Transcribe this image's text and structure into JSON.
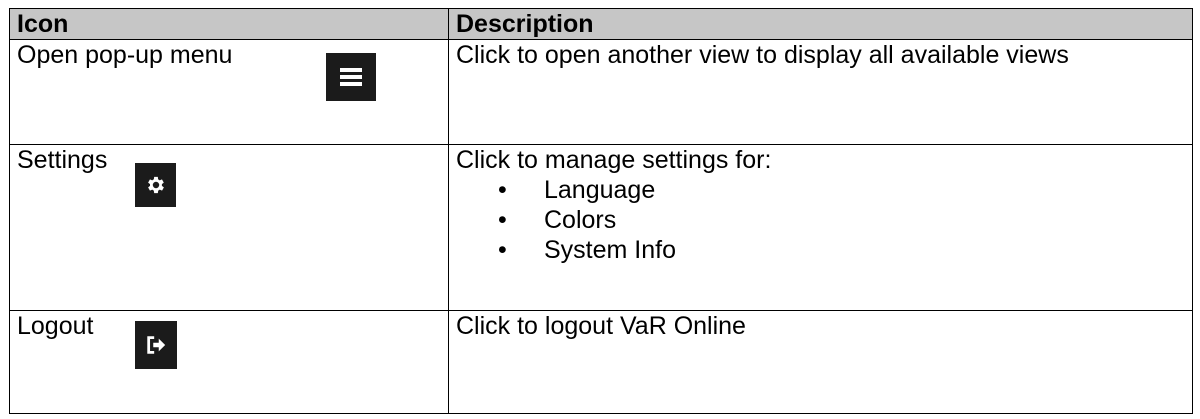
{
  "table": {
    "headers": [
      "Icon",
      "Description"
    ],
    "rows": [
      {
        "icon_label": "Open pop-up menu",
        "icon_name": "menu-icon",
        "description": "Click to open another view to display all available views"
      },
      {
        "icon_label": "Settings",
        "icon_name": "gear-icon",
        "description": "Click to manage settings for:",
        "bullets": [
          "Language",
          "Colors",
          "System Info"
        ]
      },
      {
        "icon_label": "Logout",
        "icon_name": "logout-icon",
        "description": "Click to logout VaR Online"
      }
    ]
  },
  "colors": {
    "header_bg": "#c6c6c6",
    "icon_bg": "#1b1b1b",
    "icon_fg": "#ffffff"
  }
}
